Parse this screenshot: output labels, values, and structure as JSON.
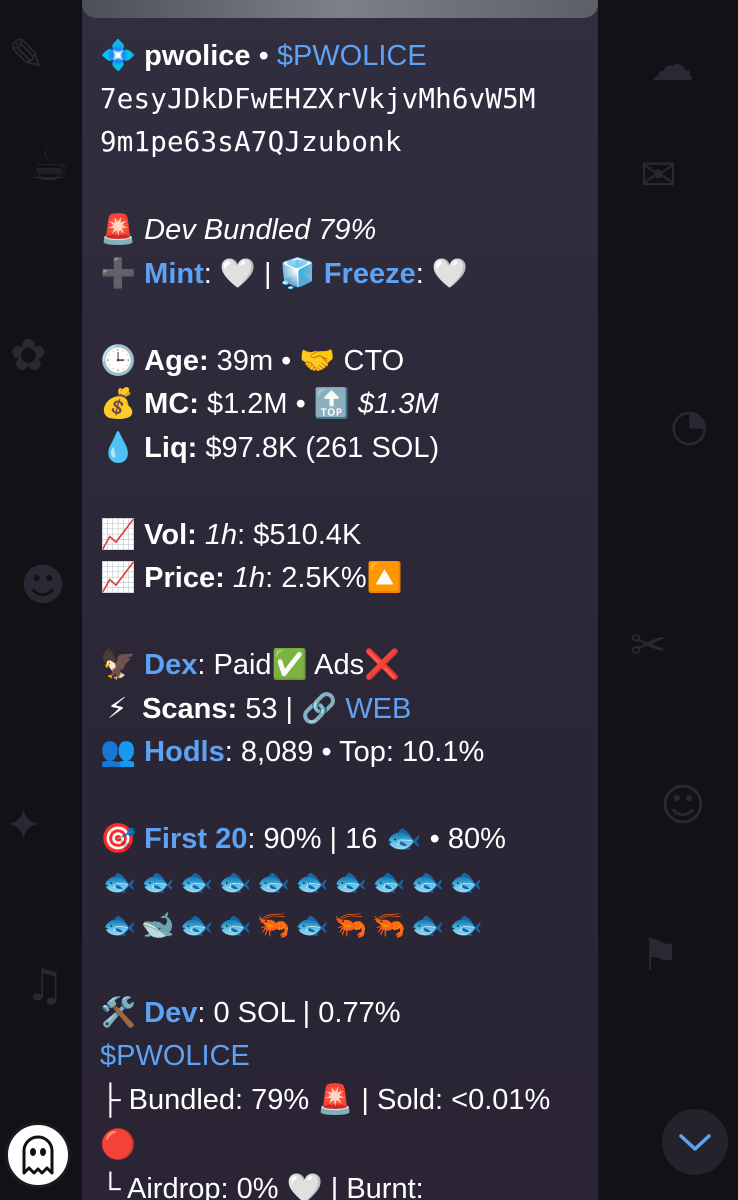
{
  "message": {
    "header": {
      "icon": "💠",
      "name": "pwolice",
      "sep": " • ",
      "ticker": "$PWOLICE"
    },
    "address": [
      "7esyJDkDFwEHZXrVkjvMh6vW5M",
      "9m1pe63sA7QJzubonk"
    ],
    "bundled": {
      "icon": "🚨",
      "text": "Dev Bundled 79%"
    },
    "mint": {
      "icon": "➕",
      "label": "Mint",
      "colon": ": ",
      "value": "🤍",
      "sep": " | ",
      "freeze_icon": "🧊",
      "freeze_label": "Freeze",
      "freeze_colon": ": ",
      "freeze_value": "🤍"
    },
    "age": {
      "icon": "🕒",
      "label": "Age:",
      "value": " 39m • ",
      "cto_icon": "🤝",
      "cto": " CTO"
    },
    "mc": {
      "icon": "💰",
      "label": "MC:",
      "value": " $1.2M • ",
      "top_icon": "🔝",
      "top_value": "$1.3M"
    },
    "liq": {
      "icon": "💧",
      "label": "Liq:",
      "value": " $97.8K (261 SOL)"
    },
    "vol": {
      "icon": "📈",
      "label": "Vol:",
      "period": "1h",
      "value": ": $510.4K"
    },
    "price": {
      "icon": "📈",
      "label": "Price:",
      "period": "1h",
      "value": ": 2.5K%",
      "trend_icon": "🔼"
    },
    "dex": {
      "icon": "🦅",
      "label": "Dex",
      "colon": ": ",
      "paid": "Paid",
      "paid_icon": "✅",
      "ads": " Ads",
      "ads_icon": "❌"
    },
    "scans": {
      "icon": "⚡",
      "label": "Scans:",
      "value": " 53 | ",
      "link_icon": "🔗",
      "link": "WEB"
    },
    "hodls": {
      "icon": "👥",
      "label": "Hodls",
      "value": ": 8,089 • Top: 10.1%"
    },
    "first20": {
      "icon": "🎯",
      "label": "First 20",
      "value": ": 90% | 16 ",
      "fish_icon": "🐟",
      "rest": " • 80%"
    },
    "holders_row1": [
      "🐟",
      "🐟",
      "🐟",
      "🐟",
      "🐟",
      "🐟",
      "🐟",
      "🐟",
      "🐟",
      "🐟"
    ],
    "holders_row2": [
      "🐟",
      "🐋",
      "🐟",
      "🐟",
      "🦐",
      "🐟",
      "🦐",
      "🦐",
      "🐟",
      "🐟"
    ],
    "dev": {
      "icon": "🛠️",
      "label": "Dev",
      "value": ": 0 SOL | 0.77%",
      "ticker": "$PWOLICE"
    },
    "bundled_line": {
      "prefix": "├",
      "text": " Bundled: 79% ",
      "icon": "🚨",
      "sold": " | Sold: <0.01% ",
      "sold_icon": "🔴"
    },
    "airdrop_line": {
      "prefix": "└",
      "text": " Airdrop: 0% ",
      "icon": "🤍",
      "burnt": " | Burnt:"
    }
  },
  "bot_avatar": {
    "icon": "ghost-icon"
  },
  "scroll_down": {
    "icon": "chevron-down-icon"
  },
  "colors": {
    "background": "#121116",
    "bubble": "#2d2939",
    "link": "#5ea2f3",
    "text": "#ffffff"
  }
}
